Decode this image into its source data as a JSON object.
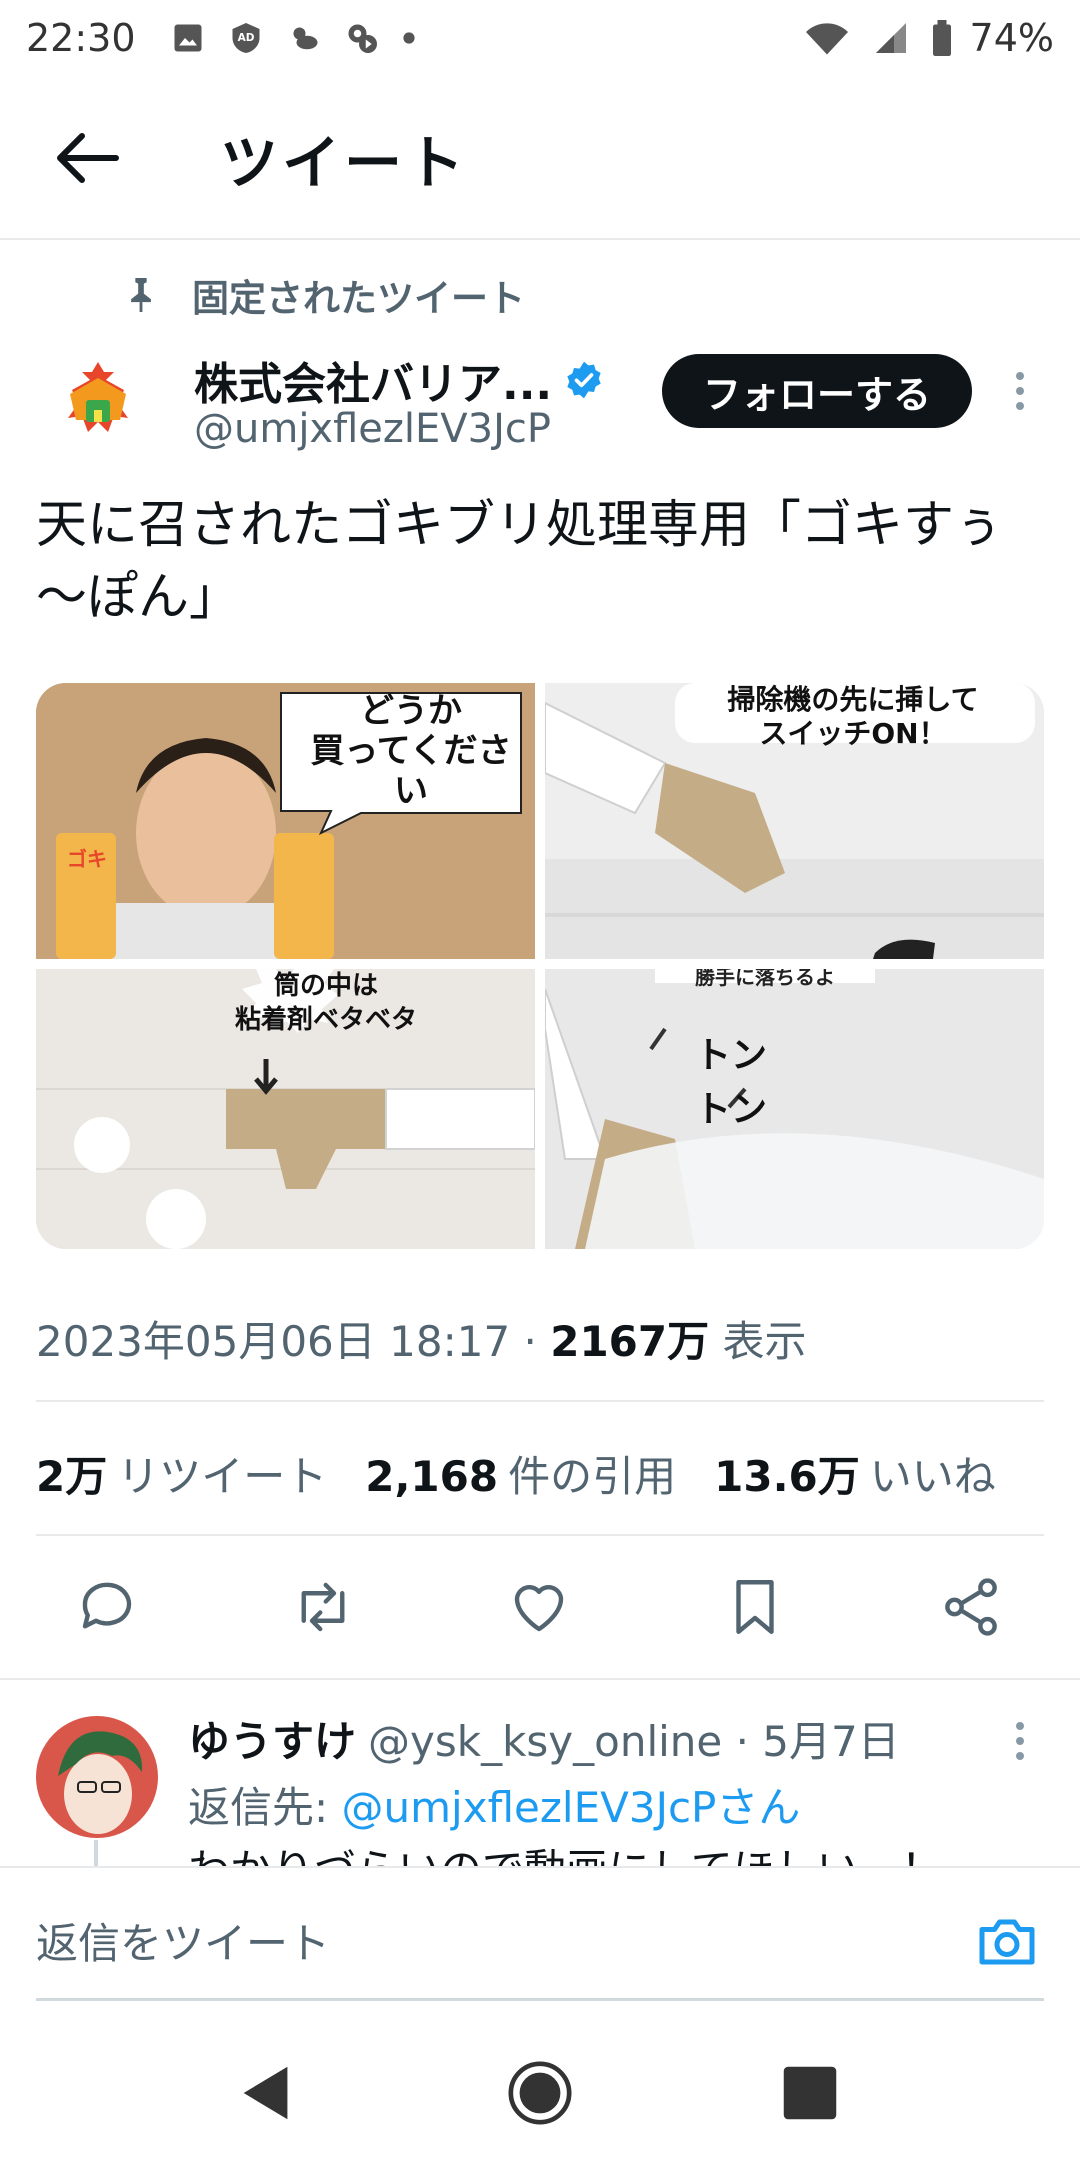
{
  "status_bar": {
    "time": "22:30",
    "battery": "74%"
  },
  "header": {
    "title": "ツイート"
  },
  "pinned_label": "固定されたツイート",
  "author": {
    "name": "株式会社バリア...",
    "handle": "@umjxflezlEV3JcP"
  },
  "follow_label": "フォローする",
  "tweet_text": "天に召されたゴキブリ処理専用「ゴキすぅ～ぽん」",
  "media_captions": {
    "img1": "どうか\n買ってください",
    "img1_package": "ゴキ",
    "img2": "掃除機の先に挿して\nスイッチON！",
    "img3": "筒の中は\n粘着剤ベタベタ",
    "img4_top": "勝手に落ちるよ",
    "img4": "トン\nトン"
  },
  "meta": {
    "datetime": "2023年05月06日 18:17 · ",
    "views_count": "2167万",
    "views_label": " 表示"
  },
  "stats": {
    "retweets_count": "2万",
    "retweets_label": "リツイート",
    "quotes_count": "2,168",
    "quotes_label": "件の引用",
    "likes_count": "13.6万",
    "likes_label": "いいね"
  },
  "reply": {
    "name": "ゆうすけ",
    "handle_date": "@ysk_ksy_online · 5月7日",
    "reply_to_prefix": "返信先: ",
    "reply_to_handle": "@umjxflezlEV3JcPさん",
    "body": "わかりづらいので動画にしてほしい…！"
  },
  "compose_placeholder": "返信をツイート",
  "colors": {
    "accent": "#1d9bf0",
    "text": "#0f1419",
    "muted": "#536471",
    "divider": "#e7e9ea"
  }
}
